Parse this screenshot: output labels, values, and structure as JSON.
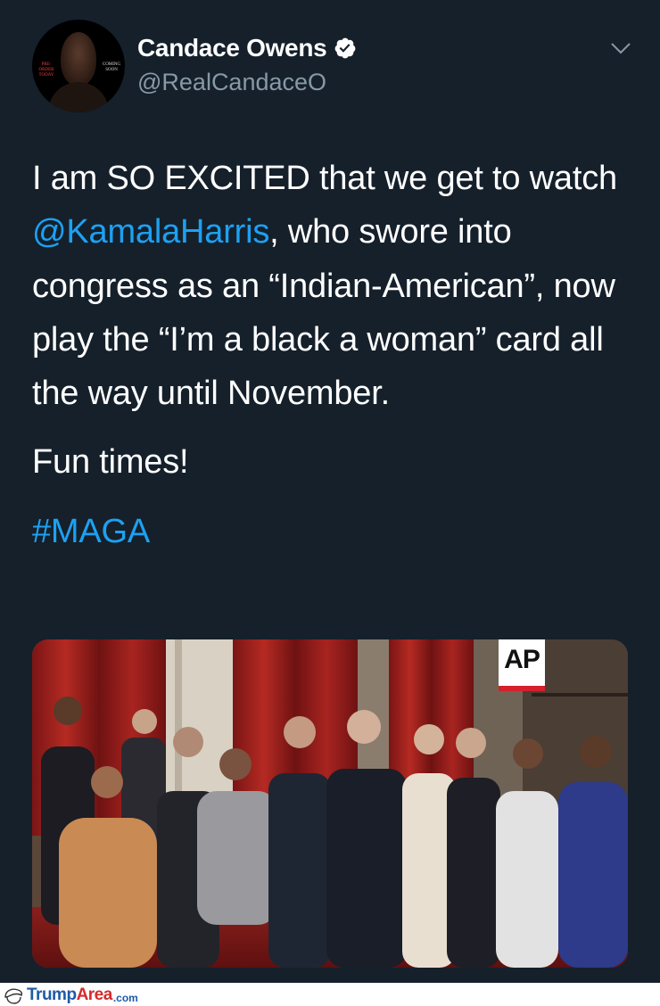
{
  "tweet": {
    "author": {
      "name": "Candace Owens",
      "handle": "@RealCandaceO",
      "verified": true,
      "avatar_text_left": "PRE-ORDER TODAY",
      "avatar_text_right": "COMING SOON"
    },
    "body": {
      "line1_pre": "I am SO EXCITED that we get to watch ",
      "mention": "@KamalaHarris",
      "line1_post": ", who swore into congress as an “Indian-American”, now play the “I’m a black a woman” card all the way until November.",
      "paragraph2": "Fun times!",
      "hashtag": "#MAGA"
    },
    "media": {
      "badge": "AP",
      "description_icon": "photo"
    },
    "menu_icon": "chevron-down-icon",
    "verified_icon": "verified-badge-icon"
  },
  "footer": {
    "brand_main": "Trump",
    "brand_accent": "Area",
    "domain": ".com",
    "icon": "trump-hair-icon"
  },
  "colors": {
    "background": "#15202b",
    "text": "#ffffff",
    "secondary": "#8899a6",
    "link": "#1da1f2",
    "verified": "#ffffff"
  }
}
